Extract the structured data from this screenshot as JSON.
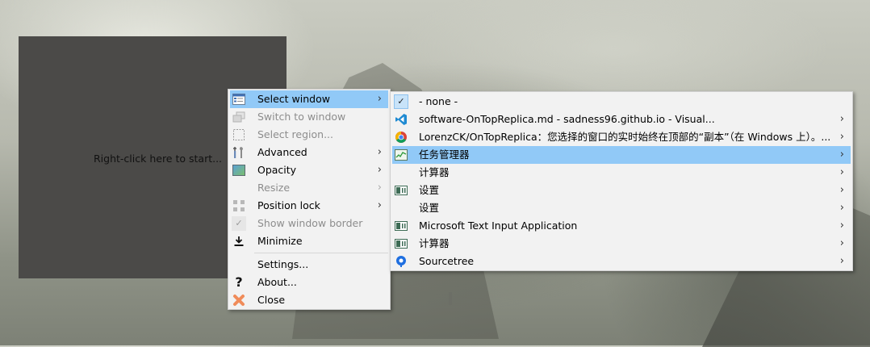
{
  "preview": {
    "hint": "Right-click here to start..."
  },
  "main_menu": {
    "items": [
      {
        "label": "Select window",
        "icon": "select-window-icon",
        "submenu": true,
        "selected": true,
        "disabled": false
      },
      {
        "label": "Switch to window",
        "icon": "switch-window-icon",
        "submenu": false,
        "disabled": true
      },
      {
        "label": "Select region...",
        "icon": "region-icon",
        "submenu": false,
        "disabled": true
      },
      {
        "label": "Advanced",
        "icon": "tools-icon",
        "submenu": true,
        "disabled": false
      },
      {
        "label": "Opacity",
        "icon": "opacity-icon",
        "submenu": true,
        "disabled": false
      },
      {
        "label": "Resize",
        "icon": "",
        "submenu": true,
        "disabled": true
      },
      {
        "label": "Position lock",
        "icon": "grid-icon",
        "submenu": true,
        "disabled": false
      },
      {
        "label": "Show window border",
        "icon": "check-icon",
        "submenu": false,
        "disabled": true
      },
      {
        "label": "Minimize",
        "icon": "minimize-icon",
        "submenu": false,
        "disabled": false
      },
      {
        "label": "Settings...",
        "icon": "",
        "submenu": false,
        "disabled": false
      },
      {
        "label": "About...",
        "icon": "question-icon",
        "submenu": false,
        "disabled": false
      },
      {
        "label": "Close",
        "icon": "close-icon",
        "submenu": false,
        "disabled": false
      }
    ]
  },
  "sub_menu": {
    "items": [
      {
        "label": "- none -",
        "icon": "check-icon",
        "submenu": false
      },
      {
        "label": "software-OnTopReplica.md - sadness96.github.io - Visual...",
        "icon": "vscode-icon",
        "submenu": true
      },
      {
        "label": "LorenzCK/OnTopReplica：您选择的窗口的实时始终在顶部的“副本”（在 Windows 上）。...",
        "icon": "chrome-icon",
        "submenu": true
      },
      {
        "label": "任务管理器",
        "icon": "task-manager-icon",
        "submenu": true,
        "selected": true
      },
      {
        "label": "计算器",
        "icon": "",
        "submenu": true
      },
      {
        "label": "设置",
        "icon": "app-window-icon",
        "submenu": true
      },
      {
        "label": "设置",
        "icon": "",
        "submenu": true
      },
      {
        "label": "Microsoft Text Input Application",
        "icon": "app-window-icon",
        "submenu": true
      },
      {
        "label": "计算器",
        "icon": "app-window-icon",
        "submenu": true
      },
      {
        "label": "Sourcetree",
        "icon": "sourcetree-icon",
        "submenu": true
      }
    ]
  },
  "glyphs": {
    "arrow": "›",
    "question": "?",
    "check": "✓"
  },
  "colors": {
    "highlight": "#91c9f7",
    "menu_bg": "#f2f2f2",
    "preview_bg": "#4b4a48"
  }
}
